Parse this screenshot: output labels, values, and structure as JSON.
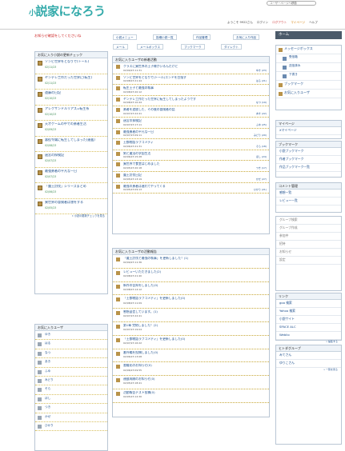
{
  "header": {
    "logo_small": "小",
    "logo_main": "説家になろう",
    "search_placeholder": "ユーザーページへ移動",
    "user_bar": [
      {
        "label": "ようこそ 9922さん",
        "cls": ""
      },
      {
        "label": "ログイン",
        "cls": ""
      },
      {
        "label": "ログアウト",
        "cls": "hl"
      },
      {
        "label": "マイページ",
        "cls": "orange"
      },
      {
        "label": "ヘルプ",
        "cls": ""
      }
    ]
  },
  "alert": "お知らせ確認をしてくださいね",
  "fav_novels": {
    "title": "お気に入り小説の更新チェック",
    "items": [
      {
        "title": "ゾンビ世界をとなりで(トール)",
        "date": "02/11/23"
      },
      {
        "title": "ヤンデレ工作だった世界に(転生)",
        "date": "02/11/23"
      },
      {
        "title": "遠藤の日記",
        "date": "02/10/23"
      },
      {
        "title": "アレクサンドルリアス=転生系",
        "date": "02/10/23"
      },
      {
        "title": "天才ゲームの中での勇者生活",
        "date": "02/09/23"
      },
      {
        "title": "悪役令嬢に転生してしまった(連載)",
        "date": "02/08/23"
      },
      {
        "title": "迷宮の探検記",
        "date": "02/07/23"
      },
      {
        "title": "最強勇者の平凡な一日",
        "date": "02/07/23"
      },
      {
        "title": "「魔王討伐」シリーズまとめ",
        "date": "02/06/23"
      },
      {
        "title": "異世界の冒険者は旅をする",
        "date": "02/05/23"
      }
    ],
    "more": "» 小説の更新チェックを見る"
  },
  "fav_users": {
    "title": "お気に入りユーザ",
    "items": [
      "ゆき",
      "はる",
      "なつ",
      "あき",
      "ふゆ",
      "みどり",
      "そら",
      "ほし",
      "つき",
      "かぜ",
      "ひかり"
    ]
  },
  "tabs": [
    {
      "label": "小説メニュー"
    },
    {
      "label": "投稿小説一覧"
    },
    {
      "label": "作品管理"
    },
    {
      "label": "お気に入り作品"
    },
    {
      "label": "メール"
    },
    {
      "label": "メールボックス"
    },
    {
      "label": "ブックマーク"
    },
    {
      "label": "ダイレクト"
    }
  ],
  "activity": {
    "title": "お気に入りユーザの新着活動",
    "items": [
      {
        "title": "クラスに異世界の王子様がいるんだけど",
        "time": "02/09/23 11:31",
        "author": "ゆき (23)"
      },
      {
        "title": "ゾンビ世界をとなりで(トール)エンドを目指す",
        "time": "02/08/23 21:44",
        "author": "はる (21)"
      },
      {
        "title": "転生王子と最強の執事",
        "time": "02/08/23 20:12",
        "author": ""
      },
      {
        "title": "ヤンデレ工作だった世界に転生してしまったようです",
        "time": "02/08/23 10:44",
        "author": "なつ (19)"
      },
      {
        "title": "勇者を追放した、その後の冒険者の話",
        "time": "02/07/23 22:41",
        "author": "あき (22)"
      },
      {
        "title": "迷宮の探検記",
        "time": "02/07/23 17:11",
        "author": "ふゆ (25)"
      },
      {
        "title": "最強勇者の平凡な一日",
        "time": "02/07/23 09:11",
        "author": "みどり (20)"
      },
      {
        "title": "王都物語ラブコメディ",
        "time": "02/06/23 21:31",
        "author": "そら (18)"
      },
      {
        "title": "剣と魔法の学園生活",
        "time": "02/06/23 15:28",
        "author": "ほし (24)"
      },
      {
        "title": "異世界で食堂はじめました",
        "time": "02/05/23 20:18",
        "author": "つき (17)"
      },
      {
        "title": "魔王討伐日記",
        "time": "02/05/23 13:19",
        "author": "かぜ (27)"
      },
      {
        "title": "最強の勇者は遅れてやってくる",
        "time": "02/05/23 09:13",
        "author": "ひかり (21)"
      }
    ]
  },
  "activity2": {
    "title": "お気に入りユーザの活動報告",
    "items": [
      {
        "title": "「魔王討伐と最強の執事」を更新しました！(1)",
        "date": "02/09/23 11:36"
      },
      {
        "title": "レビューいただきました(2)",
        "date": "02/08/23 21:40"
      },
      {
        "title": "新作の告知をしました(0)",
        "date": "02/08/23 14:12"
      },
      {
        "title": "「王都物語ラブコメディ」を更新しました(0)",
        "date": "02/08/23 11:09"
      },
      {
        "title": "感想返信しています。(1)",
        "date": "02/07/23 22:41"
      },
      {
        "title": "第1章 完結しました！(2)",
        "date": "02/07/23 19:04"
      },
      {
        "title": "「王都物語ラブコメディ」を更新しました(0)",
        "date": "02/07/23 16:22"
      },
      {
        "title": "番外編を投稿しました(0)",
        "date": "02/06/23 13:08"
      },
      {
        "title": "書籍化のお知らせ(0)",
        "date": "02/06/23 09:55"
      },
      {
        "title": "連載再開のお知らせ(0)",
        "date": "02/05/23 18:41"
      },
      {
        "title": "活動報告テスト投稿(0)",
        "date": "02/05/23 12:30"
      }
    ]
  },
  "right": {
    "home": "ホーム",
    "menu": [
      {
        "label": "メッセージボックス",
        "sub": false
      },
      {
        "label": "受信箱",
        "sub": true
      },
      {
        "label": "送信済み",
        "sub": true
      },
      {
        "label": "下書き",
        "sub": true
      },
      {
        "label": "ブックマーク",
        "sub": false
      },
      {
        "label": "お気に入りユーザ",
        "sub": false
      }
    ],
    "mypage": {
      "title": "マイページ",
      "items": [
        "Xマイページ"
      ]
    },
    "bookmark": {
      "title": "ブックマーク",
      "items": [
        "小説ブックマーク",
        "作者ブックマーク",
        "作品ブックマーク一覧"
      ]
    },
    "comment": {
      "title": "コメント管理",
      "items": [
        "感想一覧",
        "レビュー一覧"
      ]
    },
    "group": {
      "title": "グループ",
      "items": [
        "グループ検索",
        "グループ作成",
        "参加中",
        "招待",
        "お知らせ",
        "設定"
      ]
    },
    "links": {
      "title": "リンク",
      "items": [
        "goo 検索",
        "Yahoo 検索",
        "小説サイト",
        "SPACE ALC",
        "Weblio"
      ],
      "more": "» 編集する"
    },
    "hr": {
      "title": "ヒトダグループ",
      "items": [
        "みてさん",
        "ゆりこさん"
      ],
      "more": "» 一覧を見る"
    }
  }
}
